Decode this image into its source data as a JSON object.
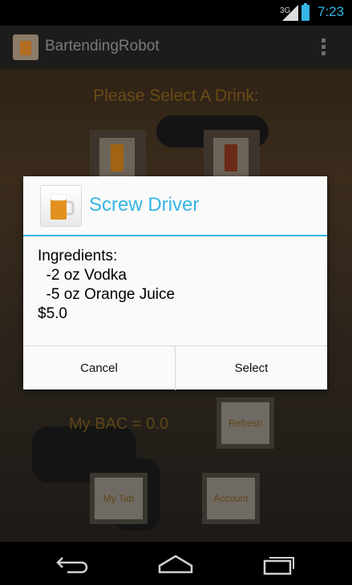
{
  "status_bar": {
    "network": "3G",
    "time": "7:23"
  },
  "action_bar": {
    "title": "BartendingRobot",
    "app_icon": "beer-mug-icon",
    "overflow_icon": "overflow-menu-icon"
  },
  "main": {
    "prompt": "Please Select A Drink:",
    "drinks": [
      {
        "icon": "orange-drink-icon"
      },
      {
        "icon": "red-drink-icon"
      }
    ],
    "bac_label": "My BAC = 0.0",
    "refresh_label": "Refresh",
    "tab_label": "My Tab",
    "account_label": "Account"
  },
  "dialog": {
    "icon": "beer-mug-icon",
    "title": "Screw Driver",
    "body": "Ingredients:\n  -2 oz Vodka\n  -5 oz Orange Juice\n$5.0",
    "cancel_label": "Cancel",
    "select_label": "Select"
  },
  "nav_bar": {
    "back_icon": "back-icon",
    "home_icon": "home-icon",
    "recents_icon": "recents-icon"
  },
  "colors": {
    "accent": "#35b5e5",
    "dialog_bg": "#fafafa"
  }
}
